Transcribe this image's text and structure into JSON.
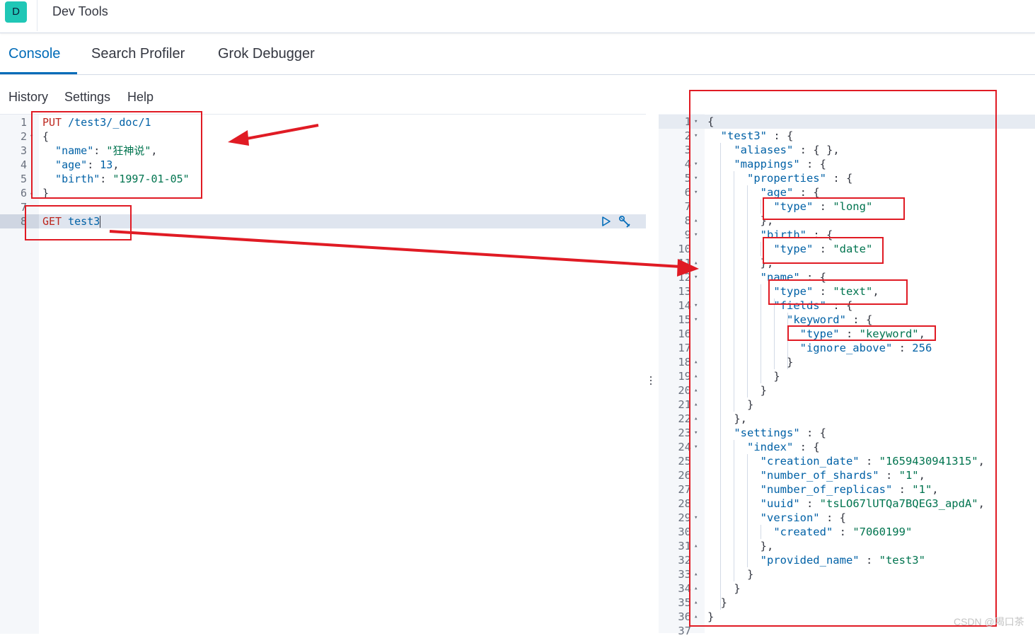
{
  "app": {
    "badge_letter": "D",
    "title": "Dev Tools"
  },
  "tabs": [
    {
      "label": "Console",
      "active": true
    },
    {
      "label": "Search Profiler",
      "active": false
    },
    {
      "label": "Grok Debugger",
      "active": false
    }
  ],
  "subnav": {
    "history": "History",
    "settings": "Settings",
    "help": "Help"
  },
  "editor": {
    "lines": [
      {
        "n": "1",
        "fold": "",
        "parts": [
          {
            "t": "PUT",
            "c": "kw"
          },
          {
            "t": " /test3/_doc/1",
            "c": "url"
          }
        ]
      },
      {
        "n": "2",
        "fold": "▾",
        "parts": [
          {
            "t": "{",
            "c": ""
          }
        ]
      },
      {
        "n": "3",
        "fold": "",
        "parts": [
          {
            "t": "  \"name\"",
            "c": "url"
          },
          {
            "t": ": ",
            "c": ""
          },
          {
            "t": "\"狂神说\"",
            "c": "str"
          },
          {
            "t": ",",
            "c": ""
          }
        ]
      },
      {
        "n": "4",
        "fold": "",
        "parts": [
          {
            "t": "  \"age\"",
            "c": "url"
          },
          {
            "t": ": ",
            "c": ""
          },
          {
            "t": "13",
            "c": "num"
          },
          {
            "t": ",",
            "c": ""
          }
        ]
      },
      {
        "n": "5",
        "fold": "",
        "parts": [
          {
            "t": "  \"birth\"",
            "c": "url"
          },
          {
            "t": ": ",
            "c": ""
          },
          {
            "t": "\"1997-01-05\"",
            "c": "str"
          }
        ]
      },
      {
        "n": "6",
        "fold": "▴",
        "parts": [
          {
            "t": "}",
            "c": ""
          }
        ]
      },
      {
        "n": "7",
        "fold": "",
        "parts": []
      },
      {
        "n": "8",
        "fold": "",
        "parts": [
          {
            "t": "GET",
            "c": "kw"
          },
          {
            "t": " test3",
            "c": "url"
          }
        ]
      }
    ]
  },
  "output": {
    "lines": [
      {
        "n": "1",
        "fold": "▾",
        "parts": [
          {
            "t": "{",
            "c": ""
          }
        ]
      },
      {
        "n": "2",
        "fold": "▾",
        "parts": [
          {
            "t": "  \"test3\"",
            "c": "ok"
          },
          {
            "t": " : {",
            "c": ""
          }
        ]
      },
      {
        "n": "3",
        "fold": "",
        "parts": [
          {
            "t": "    \"aliases\"",
            "c": "ok"
          },
          {
            "t": " : { },",
            "c": ""
          }
        ]
      },
      {
        "n": "4",
        "fold": "▾",
        "parts": [
          {
            "t": "    \"mappings\"",
            "c": "ok"
          },
          {
            "t": " : {",
            "c": ""
          }
        ]
      },
      {
        "n": "5",
        "fold": "▾",
        "parts": [
          {
            "t": "      \"properties\"",
            "c": "ok"
          },
          {
            "t": " : {",
            "c": ""
          }
        ]
      },
      {
        "n": "6",
        "fold": "▾",
        "parts": [
          {
            "t": "        \"age\"",
            "c": "ok"
          },
          {
            "t": " : {",
            "c": ""
          }
        ]
      },
      {
        "n": "7",
        "fold": "",
        "parts": [
          {
            "t": "          \"type\"",
            "c": "ok"
          },
          {
            "t": " : ",
            "c": ""
          },
          {
            "t": "\"long\"",
            "c": "os"
          }
        ]
      },
      {
        "n": "8",
        "fold": "▴",
        "parts": [
          {
            "t": "        },",
            "c": ""
          }
        ]
      },
      {
        "n": "9",
        "fold": "▾",
        "parts": [
          {
            "t": "        \"birth\"",
            "c": "ok"
          },
          {
            "t": " : {",
            "c": ""
          }
        ]
      },
      {
        "n": "10",
        "fold": "",
        "parts": [
          {
            "t": "          \"type\"",
            "c": "ok"
          },
          {
            "t": " : ",
            "c": ""
          },
          {
            "t": "\"date\"",
            "c": "os"
          }
        ]
      },
      {
        "n": "11",
        "fold": "▴",
        "parts": [
          {
            "t": "        },",
            "c": ""
          }
        ]
      },
      {
        "n": "12",
        "fold": "▾",
        "parts": [
          {
            "t": "        \"name\"",
            "c": "ok"
          },
          {
            "t": " : {",
            "c": ""
          }
        ]
      },
      {
        "n": "13",
        "fold": "",
        "parts": [
          {
            "t": "          \"type\"",
            "c": "ok"
          },
          {
            "t": " : ",
            "c": ""
          },
          {
            "t": "\"text\"",
            "c": "os"
          },
          {
            "t": ",",
            "c": ""
          }
        ]
      },
      {
        "n": "14",
        "fold": "▾",
        "parts": [
          {
            "t": "          \"fields\"",
            "c": "ok"
          },
          {
            "t": " : {",
            "c": ""
          }
        ]
      },
      {
        "n": "15",
        "fold": "▾",
        "parts": [
          {
            "t": "            \"keyword\"",
            "c": "ok"
          },
          {
            "t": " : {",
            "c": ""
          }
        ]
      },
      {
        "n": "16",
        "fold": "",
        "parts": [
          {
            "t": "              \"type\"",
            "c": "ok"
          },
          {
            "t": " : ",
            "c": ""
          },
          {
            "t": "\"keyword\"",
            "c": "os"
          },
          {
            "t": ",",
            "c": ""
          }
        ]
      },
      {
        "n": "17",
        "fold": "",
        "parts": [
          {
            "t": "              \"ignore_above\"",
            "c": "ok"
          },
          {
            "t": " : ",
            "c": ""
          },
          {
            "t": "256",
            "c": "on"
          }
        ]
      },
      {
        "n": "18",
        "fold": "▴",
        "parts": [
          {
            "t": "            }",
            "c": ""
          }
        ]
      },
      {
        "n": "19",
        "fold": "▴",
        "parts": [
          {
            "t": "          }",
            "c": ""
          }
        ]
      },
      {
        "n": "20",
        "fold": "▴",
        "parts": [
          {
            "t": "        }",
            "c": ""
          }
        ]
      },
      {
        "n": "21",
        "fold": "▴",
        "parts": [
          {
            "t": "      }",
            "c": ""
          }
        ]
      },
      {
        "n": "22",
        "fold": "▴",
        "parts": [
          {
            "t": "    },",
            "c": ""
          }
        ]
      },
      {
        "n": "23",
        "fold": "▾",
        "parts": [
          {
            "t": "    \"settings\"",
            "c": "ok"
          },
          {
            "t": " : {",
            "c": ""
          }
        ]
      },
      {
        "n": "24",
        "fold": "▾",
        "parts": [
          {
            "t": "      \"index\"",
            "c": "ok"
          },
          {
            "t": " : {",
            "c": ""
          }
        ]
      },
      {
        "n": "25",
        "fold": "",
        "parts": [
          {
            "t": "        \"creation_date\"",
            "c": "ok"
          },
          {
            "t": " : ",
            "c": ""
          },
          {
            "t": "\"1659430941315\"",
            "c": "os"
          },
          {
            "t": ",",
            "c": ""
          }
        ]
      },
      {
        "n": "26",
        "fold": "",
        "parts": [
          {
            "t": "        \"number_of_shards\"",
            "c": "ok"
          },
          {
            "t": " : ",
            "c": ""
          },
          {
            "t": "\"1\"",
            "c": "os"
          },
          {
            "t": ",",
            "c": ""
          }
        ]
      },
      {
        "n": "27",
        "fold": "",
        "parts": [
          {
            "t": "        \"number_of_replicas\"",
            "c": "ok"
          },
          {
            "t": " : ",
            "c": ""
          },
          {
            "t": "\"1\"",
            "c": "os"
          },
          {
            "t": ",",
            "c": ""
          }
        ]
      },
      {
        "n": "28",
        "fold": "",
        "parts": [
          {
            "t": "        \"uuid\"",
            "c": "ok"
          },
          {
            "t": " : ",
            "c": ""
          },
          {
            "t": "\"tsLO67lUTQa7BQEG3_apdA\"",
            "c": "os"
          },
          {
            "t": ",",
            "c": ""
          }
        ]
      },
      {
        "n": "29",
        "fold": "▾",
        "parts": [
          {
            "t": "        \"version\"",
            "c": "ok"
          },
          {
            "t": " : {",
            "c": ""
          }
        ]
      },
      {
        "n": "30",
        "fold": "",
        "parts": [
          {
            "t": "          \"created\"",
            "c": "ok"
          },
          {
            "t": " : ",
            "c": ""
          },
          {
            "t": "\"7060199\"",
            "c": "os"
          }
        ]
      },
      {
        "n": "31",
        "fold": "▴",
        "parts": [
          {
            "t": "        },",
            "c": ""
          }
        ]
      },
      {
        "n": "32",
        "fold": "",
        "parts": [
          {
            "t": "        \"provided_name\"",
            "c": "ok"
          },
          {
            "t": " : ",
            "c": ""
          },
          {
            "t": "\"test3\"",
            "c": "os"
          }
        ]
      },
      {
        "n": "33",
        "fold": "▴",
        "parts": [
          {
            "t": "      }",
            "c": ""
          }
        ]
      },
      {
        "n": "34",
        "fold": "▴",
        "parts": [
          {
            "t": "    }",
            "c": ""
          }
        ]
      },
      {
        "n": "35",
        "fold": "▴",
        "parts": [
          {
            "t": "  }",
            "c": ""
          }
        ]
      },
      {
        "n": "36",
        "fold": "▴",
        "parts": [
          {
            "t": "}",
            "c": ""
          }
        ]
      },
      {
        "n": "37",
        "fold": "",
        "parts": []
      }
    ]
  },
  "icons": {
    "run": "play-icon",
    "wrench": "wrench-icon",
    "resize": "vertical-dots-icon"
  },
  "colors": {
    "accent": "#006bb8",
    "keyword": "#bd271e",
    "string": "#00744f",
    "annotation": "#e01b24",
    "badge": "#20c7b6"
  },
  "watermark": "CSDN @喝口茶"
}
